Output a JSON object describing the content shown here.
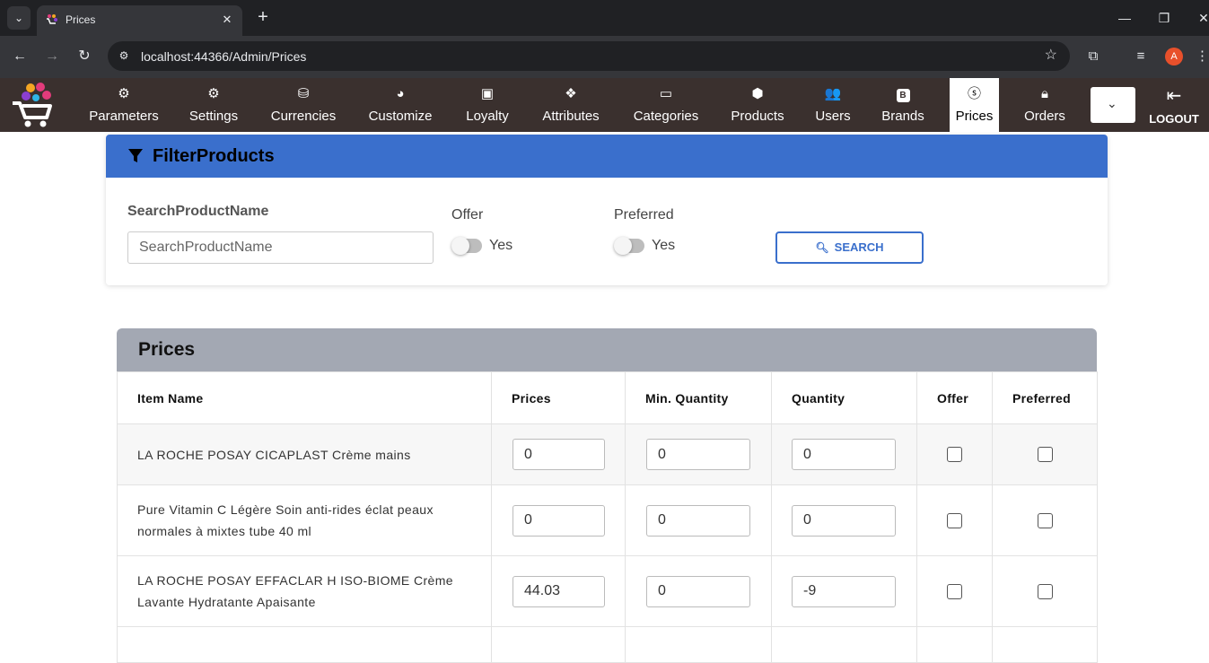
{
  "browser": {
    "tab_title": "Prices",
    "url": "localhost:44366/Admin/Prices",
    "profile_initial": "A"
  },
  "nav": {
    "items": [
      {
        "label": "Parameters",
        "icon": "gear-outline-icon"
      },
      {
        "label": "Settings",
        "icon": "gear-icon"
      },
      {
        "label": "Currencies",
        "icon": "coins-icon"
      },
      {
        "label": "Customize",
        "icon": "edge-icon"
      },
      {
        "label": "Loyalty",
        "icon": "card-icon"
      },
      {
        "label": "Attributes",
        "icon": "diamond-icon"
      },
      {
        "label": "Categories",
        "icon": "box-icon"
      },
      {
        "label": "Products",
        "icon": "cube-icon"
      },
      {
        "label": "Users",
        "icon": "users-icon"
      },
      {
        "label": "Brands",
        "icon": "brand-badge-icon"
      },
      {
        "label": "Prices",
        "icon": "dollar-circle-icon"
      },
      {
        "label": "Orders",
        "icon": "bag-icon"
      }
    ],
    "active": "Prices",
    "brand_badge_letter": "B",
    "logout_label": "LOGOUT"
  },
  "filter": {
    "title": "FilterProducts",
    "search_label": "SearchProductName",
    "search_placeholder": "SearchProductName",
    "search_value": "",
    "offer_label": "Offer",
    "offer_toggle_label": "Yes",
    "offer_on": false,
    "preferred_label": "Preferred",
    "preferred_toggle_label": "Yes",
    "preferred_on": false,
    "search_button": "SEARCH"
  },
  "prices": {
    "title": "Prices",
    "columns": [
      "Item Name",
      "Prices",
      "Min. Quantity",
      "Quantity",
      "Offer",
      "Preferred"
    ],
    "rows": [
      {
        "name": "LA ROCHE POSAY CICAPLAST Crème mains",
        "price": "0",
        "min_qty": "0",
        "qty": "0",
        "offer": false,
        "preferred": false
      },
      {
        "name": "Pure Vitamin C Légère Soin anti-rides éclat peaux normales à mixtes tube 40 ml",
        "price": "0",
        "min_qty": "0",
        "qty": "0",
        "offer": false,
        "preferred": false
      },
      {
        "name": "LA ROCHE POSAY EFFACLAR H ISO-BIOME Crème Lavante Hydratante Apaisante",
        "price": "44.03",
        "min_qty": "0",
        "qty": "-9",
        "offer": false,
        "preferred": false
      }
    ]
  },
  "colors": {
    "filter_header": "#3a6fcc",
    "prices_header": "#a3a8b3",
    "navbar": "#3a302e"
  }
}
